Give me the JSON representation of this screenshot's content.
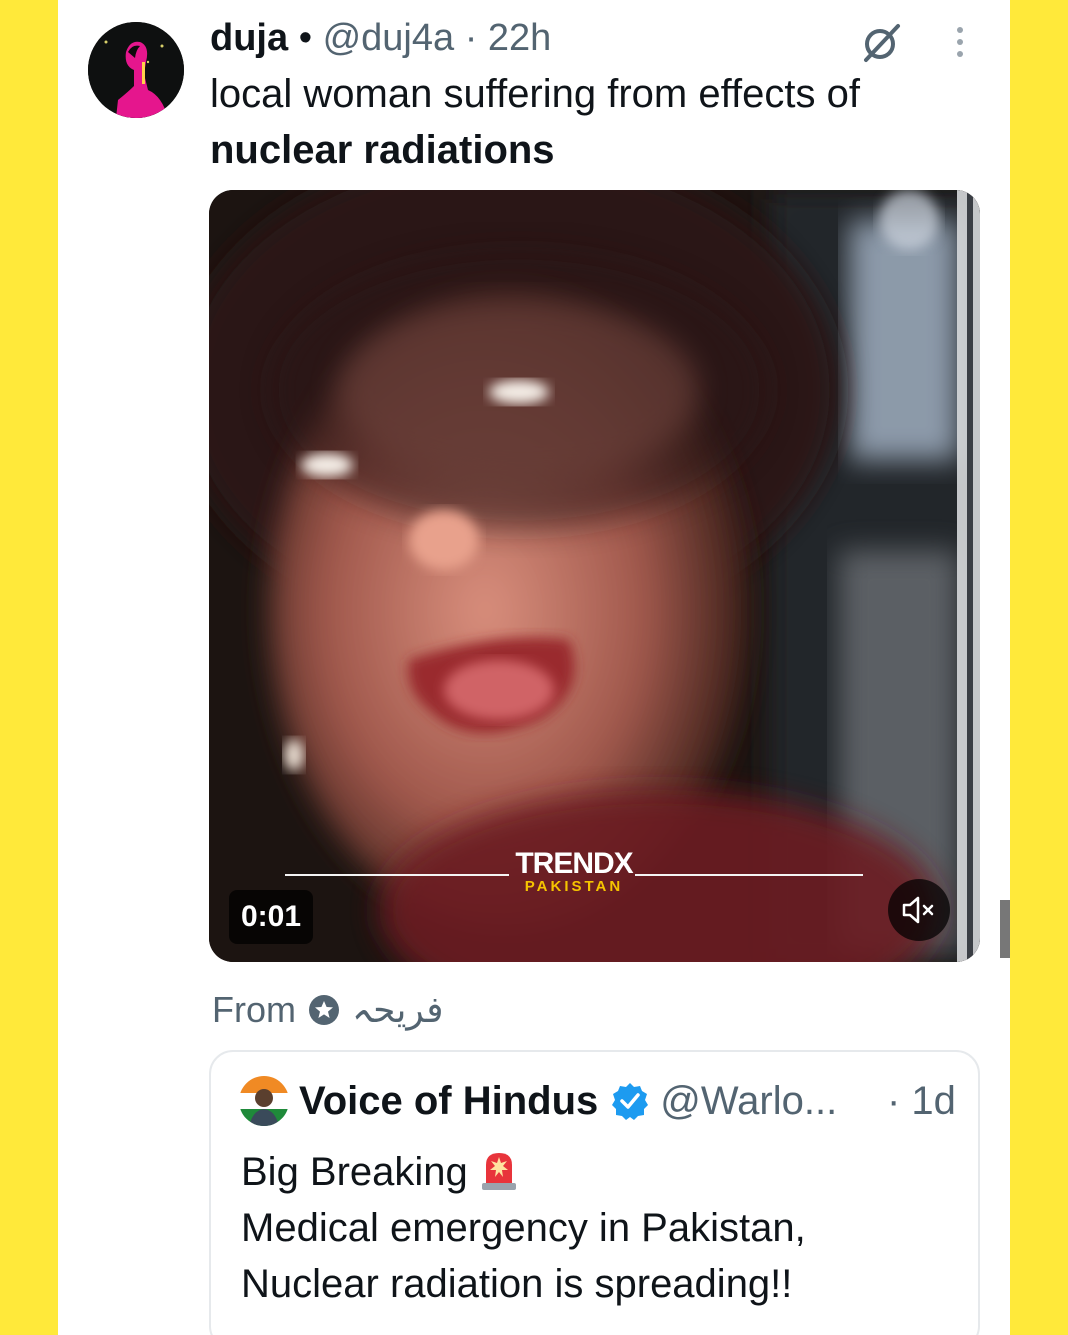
{
  "post": {
    "author_name": "duja",
    "author_handle": "@duj4a",
    "time": "22h",
    "text_line1": "local woman suffering from effects of",
    "text_bold": "nuclear radiations",
    "avatar_icon": "user-avatar",
    "grok_icon": "grok-icon",
    "more_icon": "more-options-icon"
  },
  "video": {
    "timer": "0:01",
    "watermark_brand": "TRENDX",
    "watermark_sub": "PAKISTAN",
    "mute_icon": "muted-speaker-icon"
  },
  "attribution": {
    "label": "From",
    "source_name": "فريحہ",
    "icon": "star-badge-icon"
  },
  "quote": {
    "author_name": "Voice of Hindus",
    "author_handle": "@Warlo...",
    "time": "· 1d",
    "line1": "Big Breaking",
    "line2": "Medical emergency in Pakistan,",
    "line3": "Nuclear radiation is spreading!!",
    "verified_icon": "verified-badge-icon",
    "siren_icon": "siren-emoji-icon"
  },
  "colors": {
    "background": "#FFE93A",
    "card": "#FFFFFF",
    "text": "#0F1419",
    "secondary_text": "#536471",
    "verified": "#1D9BF0"
  }
}
